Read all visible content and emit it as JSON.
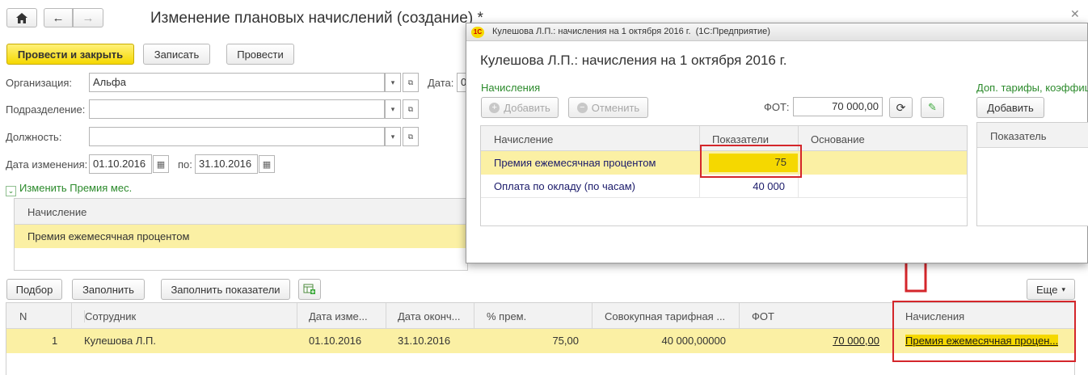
{
  "main": {
    "title": "Изменение плановых начислений (создание) *",
    "toolbar": {
      "post_close": "Провести и закрыть",
      "save": "Записать",
      "post": "Провести"
    },
    "fields": {
      "org_label": "Организация:",
      "org_value": "Альфа",
      "dept_label": "Подразделение:",
      "dept_value": "",
      "pos_label": "Должность:",
      "pos_value": "",
      "date_label": "Дата:",
      "date_value": "0",
      "change_date_label": "Дата изменения:",
      "change_date_from": "01.10.2016",
      "to_label": "по:",
      "change_date_to": "31.10.2016"
    },
    "change_section": "Изменить Премия мес.",
    "accrual_table": {
      "header": "Начисление",
      "rows": [
        "Премия ежемесячная процентом"
      ]
    },
    "actions": {
      "select": "Подбор",
      "fill": "Заполнить",
      "fill_indicators": "Заполнить показатели",
      "more": "Еще"
    },
    "employees": {
      "headers": [
        "N",
        "Сотрудник",
        "Дата изме...",
        "Дата оконч...",
        "% прем.",
        "Совокупная тарифная ...",
        "ФОТ",
        "Начисления"
      ],
      "rows": [
        {
          "n": "1",
          "employee": "Кулешова Л.П.",
          "date_change": "01.10.2016",
          "date_end": "31.10.2016",
          "percent": "75,00",
          "tariff": "40 000,00000",
          "fot": "70 000,00",
          "accruals": "Премия ежемесячная процен..."
        }
      ]
    }
  },
  "dialog": {
    "window_title": "Кулешова Л.П.: начисления на 1 октября 2016 г.  (1С:Предприятие)",
    "title": "Кулешова Л.П.: начисления на 1 октября 2016 г.",
    "section": "Начисления",
    "add": "Добавить",
    "cancel": "Отменить",
    "fot_label": "ФОТ:",
    "fot_value": "70 000,00",
    "right_section": "Доп. тарифы, коэффиц",
    "right_add": "Добавить",
    "right_header": "Показатель",
    "headers": [
      "Начисление",
      "Показатели",
      "Основание"
    ],
    "rows": [
      {
        "name": "Премия ежемесячная процентом",
        "value": "75",
        "basis": ""
      },
      {
        "name": "Оплата по окладу (по часам)",
        "value": "40 000",
        "basis": ""
      }
    ]
  },
  "colors": {
    "accent_yellow": "#f5d800",
    "selected_row": "#fbf0a4",
    "highlight_red": "#d4262b",
    "link_green": "#2b8a2b"
  }
}
